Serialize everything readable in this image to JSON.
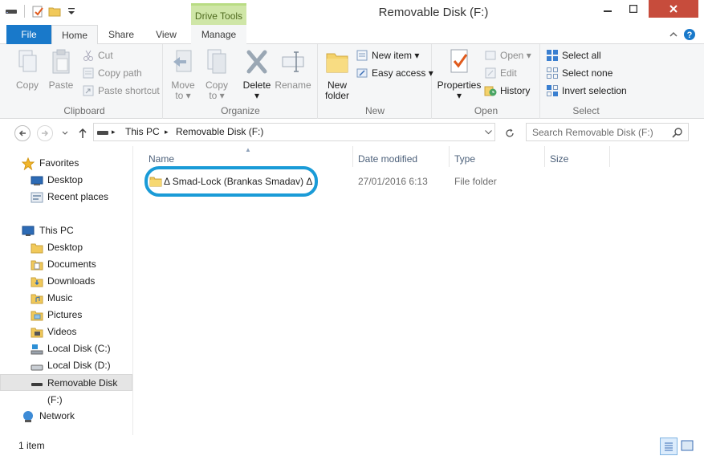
{
  "window": {
    "title": "Removable Disk (F:)",
    "context_tab_header": "Drive Tools"
  },
  "tabs": {
    "file": "File",
    "home": "Home",
    "share": "Share",
    "view": "View",
    "manage": "Manage"
  },
  "ribbon": {
    "clipboard": {
      "label": "Clipboard",
      "copy": "Copy",
      "paste": "Paste",
      "cut": "Cut",
      "copy_path": "Copy path",
      "paste_shortcut": "Paste shortcut"
    },
    "organize": {
      "label": "Organize",
      "move_to": "Move",
      "move_to2": "to",
      "copy_to": "Copy",
      "copy_to2": "to",
      "delete": "Delete",
      "rename": "Rename"
    },
    "new": {
      "label": "New",
      "new_folder": "New",
      "new_folder2": "folder",
      "new_item": "New item",
      "easy_access": "Easy access"
    },
    "open": {
      "label": "Open",
      "properties": "Properties",
      "open": "Open",
      "edit": "Edit",
      "history": "History"
    },
    "select": {
      "label": "Select",
      "select_all": "Select all",
      "select_none": "Select none",
      "invert": "Invert selection"
    }
  },
  "address": {
    "crumbs": [
      "This PC",
      "Removable Disk (F:)"
    ]
  },
  "search": {
    "placeholder": "Search Removable Disk (F:)"
  },
  "nav": {
    "favorites": "Favorites",
    "fav_items": [
      "Desktop",
      "Recent places"
    ],
    "this_pc": "This PC",
    "pc_items": [
      "Desktop",
      "Documents",
      "Downloads",
      "Music",
      "Pictures",
      "Videos",
      "Local Disk (C:)",
      "Local Disk (D:)",
      "Removable Disk (F:)"
    ],
    "network": "Network"
  },
  "columns": {
    "name": "Name",
    "date": "Date modified",
    "type": "Type",
    "size": "Size"
  },
  "files": [
    {
      "name": "Δ Smad-Lock (Brankas Smadav) Δ",
      "date": "27/01/2016 6:13",
      "type": "File folder"
    }
  ],
  "status": {
    "count": "1 item"
  },
  "colors": {
    "accent": "#1979ca",
    "highlight_ring": "#1a9bd7",
    "context_tab": "#cfe6a7"
  }
}
